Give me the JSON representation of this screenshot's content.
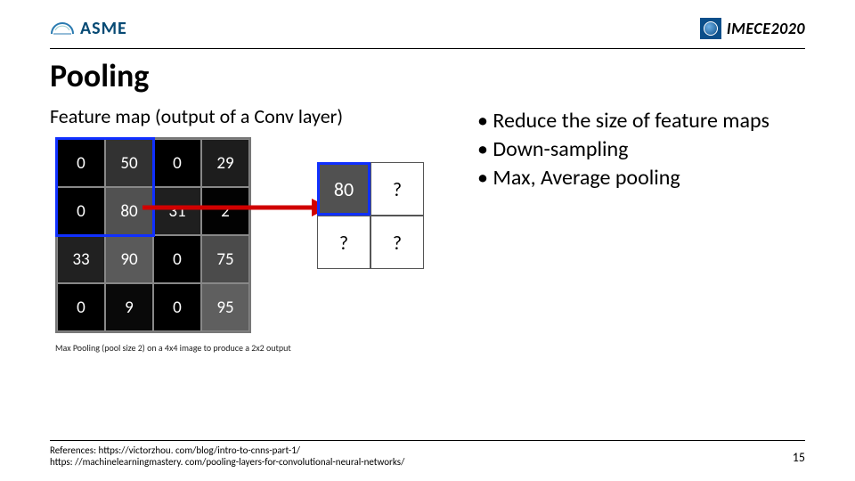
{
  "header": {
    "logo_left_text": "ASME",
    "logo_right_text": "IMECE2020"
  },
  "title": "Pooling",
  "left": {
    "subhead": "Feature map (output of a Conv layer)",
    "caption": "Max Pooling (pool size 2) on a 4x4 image to produce a 2x2 output",
    "feature_map": {
      "rows": [
        [
          {
            "v": "0",
            "bg": "#000"
          },
          {
            "v": "50",
            "bg": "#323232"
          },
          {
            "v": "0",
            "bg": "#000"
          },
          {
            "v": "29",
            "bg": "#1d1d1d"
          }
        ],
        [
          {
            "v": "0",
            "bg": "#000"
          },
          {
            "v": "80",
            "bg": "#515151"
          },
          {
            "v": "31",
            "bg": "#1f1f1f"
          },
          {
            "v": "2",
            "bg": "#020202"
          }
        ],
        [
          {
            "v": "33",
            "bg": "#212121"
          },
          {
            "v": "90",
            "bg": "#5a5a5a"
          },
          {
            "v": "0",
            "bg": "#000"
          },
          {
            "v": "75",
            "bg": "#4b4b4b"
          }
        ],
        [
          {
            "v": "0",
            "bg": "#000"
          },
          {
            "v": "9",
            "bg": "#090909"
          },
          {
            "v": "0",
            "bg": "#000"
          },
          {
            "v": "95",
            "bg": "#5f5f5f"
          }
        ]
      ]
    },
    "output_grid": {
      "cells": [
        {
          "v": "80",
          "bg": "#515151",
          "fg": "#fff",
          "hl": true
        },
        {
          "v": "?",
          "bg": "#fff",
          "fg": "#000",
          "hl": false
        },
        {
          "v": "?",
          "bg": "#fff",
          "fg": "#000",
          "hl": false
        },
        {
          "v": "?",
          "bg": "#fff",
          "fg": "#000",
          "hl": false
        }
      ]
    }
  },
  "right": {
    "bullets": [
      "Reduce the size of feature maps",
      "Down-sampling",
      "Max, Average pooling"
    ]
  },
  "footer": {
    "refs": [
      "References: https://victorzhou. com/blog/intro-to-cnns-part-1/",
      "https: //machinelearningmastery. com/pooling-layers-for-convolutional-neural-networks/"
    ],
    "page": "15"
  }
}
